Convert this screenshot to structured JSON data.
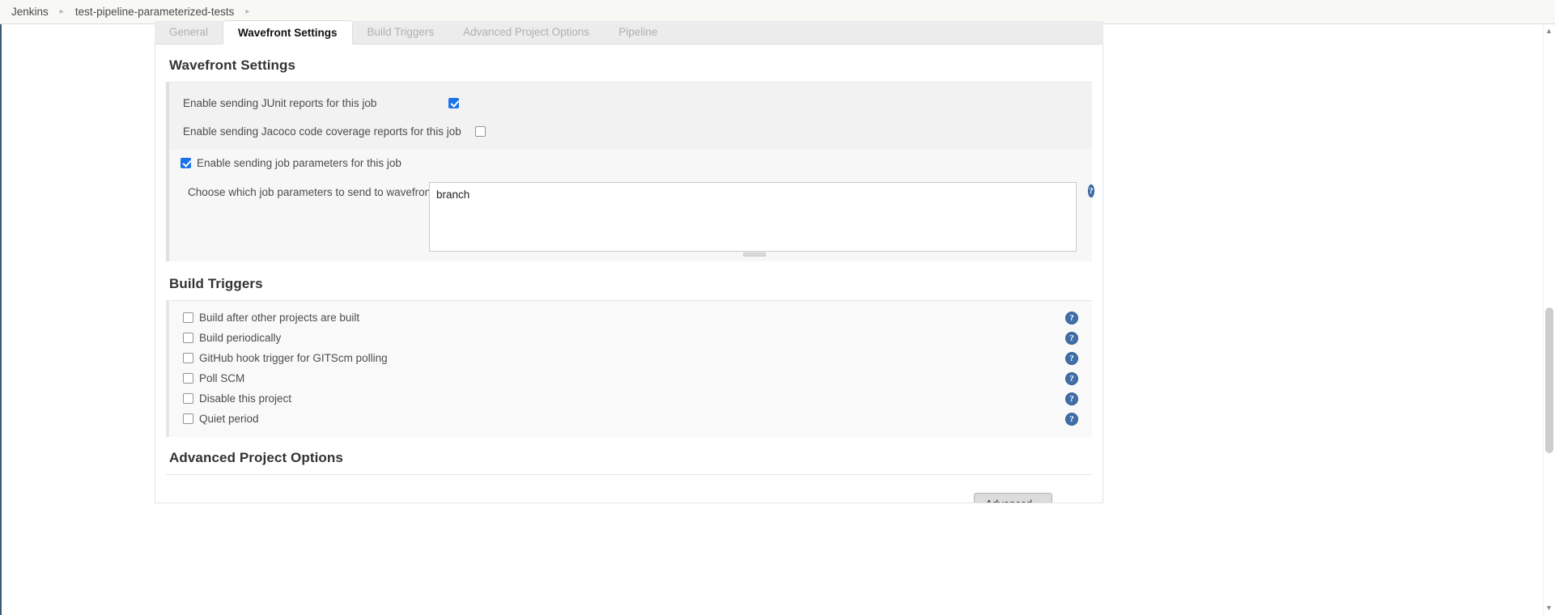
{
  "breadcrumb": {
    "items": [
      {
        "label": "Jenkins"
      },
      {
        "label": "test-pipeline-parameterized-tests"
      }
    ],
    "separator": "▸"
  },
  "tabs": [
    {
      "label": "General",
      "active": false
    },
    {
      "label": "Wavefront Settings",
      "active": true
    },
    {
      "label": "Build Triggers",
      "active": false
    },
    {
      "label": "Advanced Project Options",
      "active": false
    },
    {
      "label": "Pipeline",
      "active": false
    }
  ],
  "wavefront": {
    "heading": "Wavefront Settings",
    "junit_label": "Enable sending JUnit reports for this job",
    "junit_checked": true,
    "jacoco_label": "Enable sending Jacoco code coverage reports for this job",
    "jacoco_checked": false,
    "job_params_label": "Enable sending job parameters for this job",
    "job_params_checked": true,
    "choose_params_label": "Choose which job parameters to send to wavefront",
    "params_value": "branch",
    "params_placeholder": "",
    "help_icon": "help-icon",
    "help_glyph": "?"
  },
  "build_triggers": {
    "heading": "Build Triggers",
    "items": [
      {
        "label": "Build after other projects are built",
        "checked": false
      },
      {
        "label": "Build periodically",
        "checked": false
      },
      {
        "label": "GitHub hook trigger for GITScm polling",
        "checked": false
      },
      {
        "label": "Poll SCM",
        "checked": false
      },
      {
        "label": "Disable this project",
        "checked": false
      },
      {
        "label": "Quiet period",
        "checked": false
      }
    ],
    "help_glyph": "?"
  },
  "advanced_project_options": {
    "heading": "Advanced Project Options",
    "advanced_button": "Advanced..."
  },
  "scrollbar": {
    "up_arrow": "▲",
    "down_arrow": "▼"
  },
  "colors": {
    "accent_blue": "#1a73e8",
    "help_blue": "#3f6ea8",
    "breadcrumb_bg": "#f8f8f5",
    "tab_bg": "#ececec",
    "row_bg": "#f2f2f2"
  }
}
